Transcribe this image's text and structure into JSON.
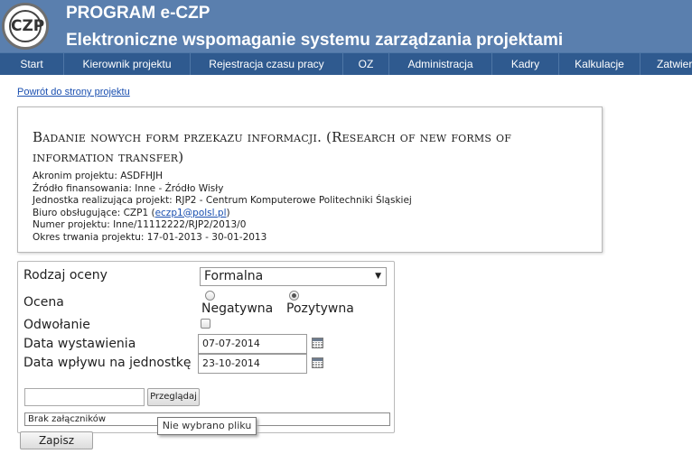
{
  "app": {
    "logo_text": "CZP",
    "title": "PROGRAM e-CZP",
    "subtitle": "Elektroniczne wspomaganie systemu zarządzania projektami"
  },
  "nav": [
    {
      "label": "Start"
    },
    {
      "label": "Kierownik projektu"
    },
    {
      "label": "Rejestracja czasu pracy"
    },
    {
      "label": "OZ"
    },
    {
      "label": "Administracja"
    },
    {
      "label": "Kadry"
    },
    {
      "label": "Kalkulacje"
    },
    {
      "label": "Zatwier"
    }
  ],
  "back_link": "Powrót do strony projektu",
  "project": {
    "title": "Badanie nowych form przekazu informacji. (Research of new forms of information transfer)",
    "acronym": "Akronim projektu: ASDFHJH",
    "funding": "Źródło finansowania: Inne - Źródło Wisły",
    "unit": "Jednostka realizująca projekt: RJP2 - Centrum Komputerowe Politechniki Śląskiej",
    "office_prefix": "Biuro obsługujące: CZP1 (",
    "office_email": "eczp1@polsl.pl",
    "office_suffix": ")",
    "number": "Numer projektu: Inne/11112222/RJP2/2013/0",
    "period": "Okres trwania projektu: 17-01-2013 - 30-01-2013"
  },
  "form": {
    "rating_type_label": "Rodzaj oceny",
    "rating_type_value": "Formalna",
    "rating_label": "Ocena",
    "rating_options": [
      "Negatywna",
      "Pozytywna"
    ],
    "rating_selected": "Pozytywna",
    "appeal_label": "Odwołanie",
    "issue_date_label": "Data wystawienia",
    "issue_date_value": "07-07-2014",
    "receipt_date_label": "Data wpływu na jednostkę",
    "receipt_date_value": "23-10-2014",
    "browse_label": "Przeglądaj",
    "attachments_text": "Brak załączników",
    "tooltip_text": "Nie wybrano pliku",
    "save_label": "Zapisz ocenę"
  },
  "colors": {
    "header": "#5a7fae",
    "nav": "#2f5a8f",
    "link": "#1a4fb0"
  }
}
